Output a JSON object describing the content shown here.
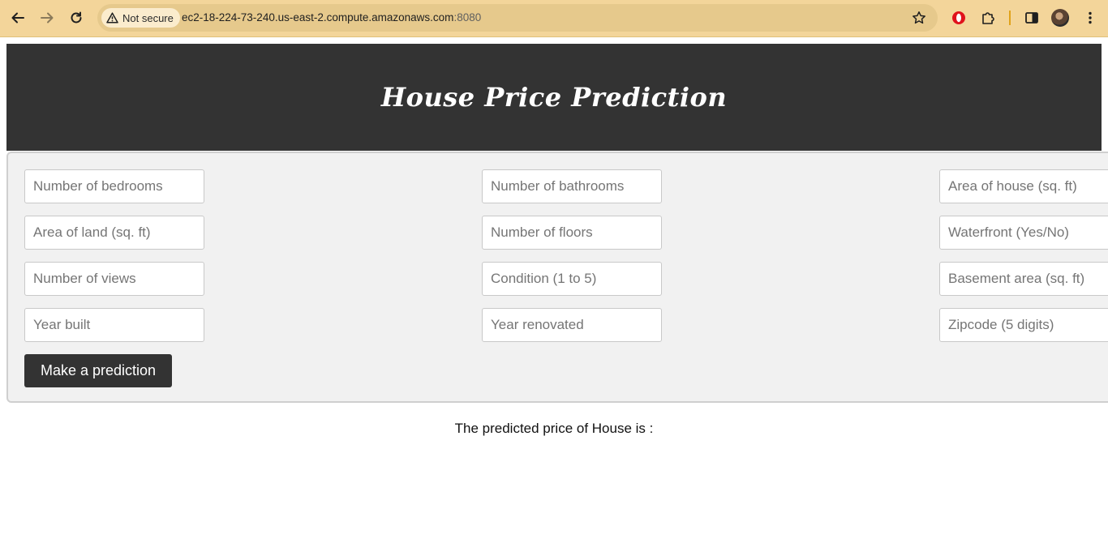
{
  "browser": {
    "security_label": "Not secure",
    "url_host": "ec2-18-224-73-240.us-east-2.compute.amazonaws.com",
    "url_port": ":8080",
    "accent_color": "#f3d59a"
  },
  "header": {
    "title": "House Price Prediction"
  },
  "form": {
    "bedrooms_placeholder": "Number of bedrooms",
    "bathrooms_placeholder": "Number of bathrooms",
    "house_area_placeholder": "Area of house (sq. ft)",
    "land_area_placeholder": "Area of land (sq. ft)",
    "floors_placeholder": "Number of floors",
    "waterfront_placeholder": "Waterfront (Yes/No)",
    "views_placeholder": "Number of views",
    "condition_placeholder": "Condition (1 to 5)",
    "basement_placeholder": "Basement area (sq. ft)",
    "year_built_placeholder": "Year built",
    "year_renovated_placeholder": "Year renovated",
    "zipcode_placeholder": "Zipcode (5 digits)",
    "submit_label": "Make a prediction"
  },
  "result": {
    "text": "The predicted price of House is :"
  }
}
